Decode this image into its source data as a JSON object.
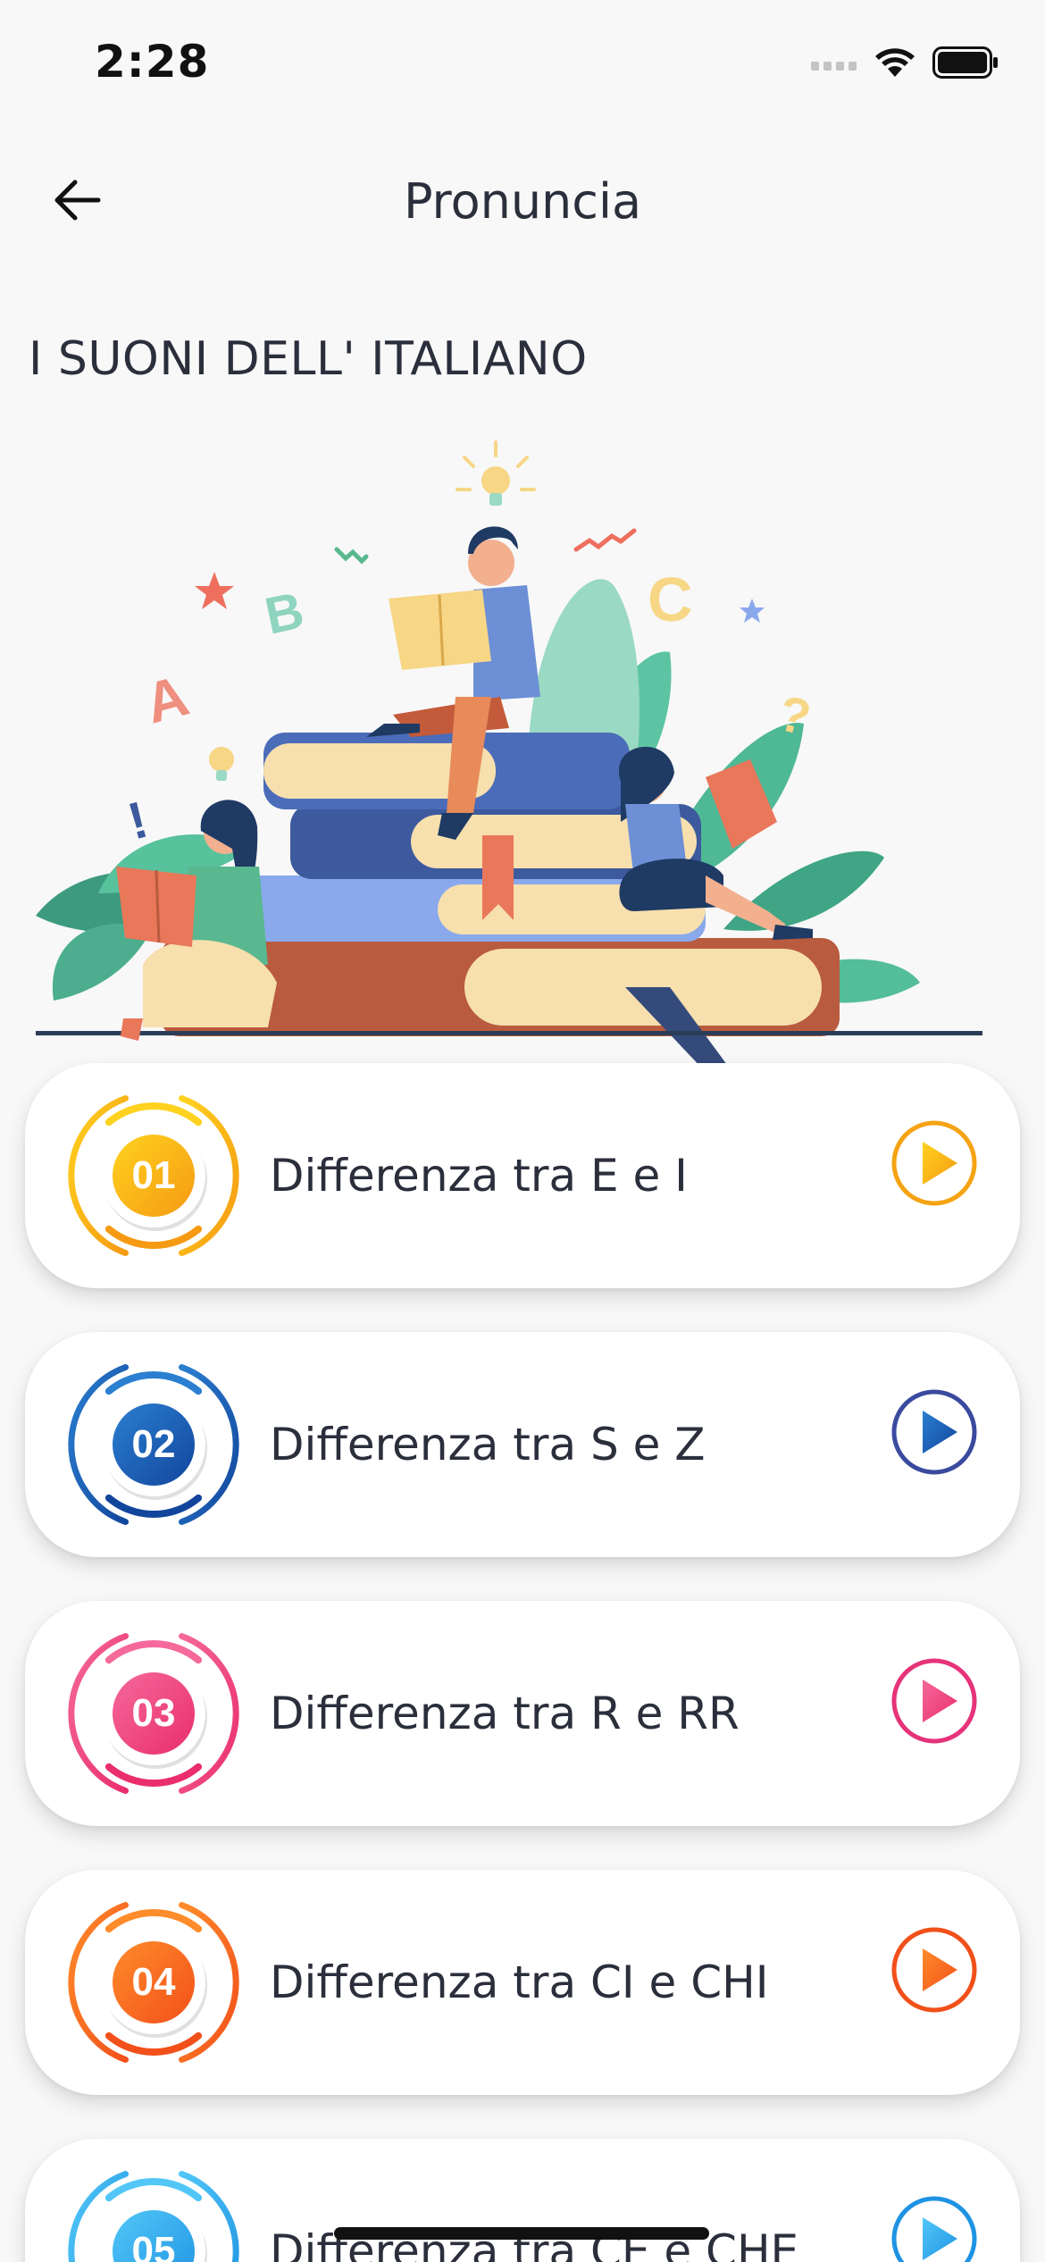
{
  "status_bar": {
    "time": "2:28",
    "battery_level": 0.95
  },
  "nav": {
    "title": "Pronuncia",
    "back_icon": "arrow-left-icon"
  },
  "section": {
    "title": "I SUONI DELL' ITALIANO"
  },
  "illustration": {
    "letters": [
      "A",
      "B",
      "C"
    ],
    "symbols": [
      "!",
      "?"
    ]
  },
  "lessons": [
    {
      "number": "01",
      "label": "Differenza tra E e I",
      "color": "#f59a12",
      "color_light": "#ffd21f"
    },
    {
      "number": "02",
      "label": "Differenza tra S e Z",
      "color": "#12469c",
      "color_light": "#2b7fd1"
    },
    {
      "number": "03",
      "label": "Differenza tra R e RR",
      "color": "#ea2e6c",
      "color_light": "#f5699b"
    },
    {
      "number": "04",
      "label": "Differenza tra CI e CHI",
      "color": "#f2501a",
      "color_light": "#ff8c2b"
    },
    {
      "number": "05",
      "label": "Differenza tra CE e CHE",
      "color": "#1f93e3",
      "color_light": "#52c7f7"
    }
  ],
  "play_ring_colors": [
    "#f5a313",
    "#3a4a9e",
    "#e6337a",
    "#f2501a",
    "#1f93e3"
  ]
}
